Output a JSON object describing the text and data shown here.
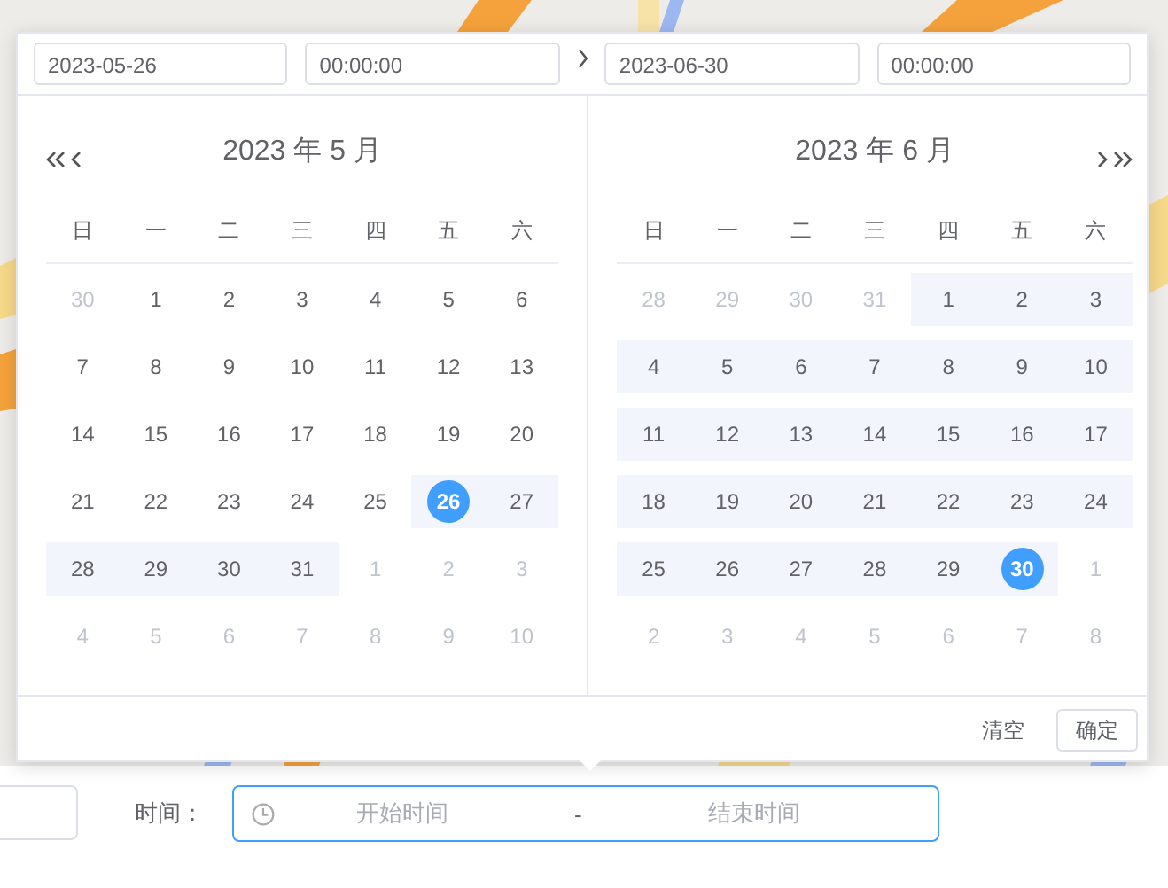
{
  "picker": {
    "start_date": "2023-05-26",
    "start_time": "00:00:00",
    "end_date": "2023-06-30",
    "end_time": "00:00:00",
    "panels": [
      {
        "title": "2023 年 5 月",
        "weekdays": [
          "日",
          "一",
          "二",
          "三",
          "四",
          "五",
          "六"
        ],
        "weeks": [
          [
            {
              "d": "30",
              "muted": true,
              "in_range": false,
              "selected": false
            },
            {
              "d": "1",
              "muted": false,
              "in_range": false,
              "selected": false
            },
            {
              "d": "2",
              "muted": false,
              "in_range": false,
              "selected": false
            },
            {
              "d": "3",
              "muted": false,
              "in_range": false,
              "selected": false
            },
            {
              "d": "4",
              "muted": false,
              "in_range": false,
              "selected": false
            },
            {
              "d": "5",
              "muted": false,
              "in_range": false,
              "selected": false
            },
            {
              "d": "6",
              "muted": false,
              "in_range": false,
              "selected": false
            }
          ],
          [
            {
              "d": "7",
              "muted": false,
              "in_range": false,
              "selected": false
            },
            {
              "d": "8",
              "muted": false,
              "in_range": false,
              "selected": false
            },
            {
              "d": "9",
              "muted": false,
              "in_range": false,
              "selected": false
            },
            {
              "d": "10",
              "muted": false,
              "in_range": false,
              "selected": false
            },
            {
              "d": "11",
              "muted": false,
              "in_range": false,
              "selected": false
            },
            {
              "d": "12",
              "muted": false,
              "in_range": false,
              "selected": false
            },
            {
              "d": "13",
              "muted": false,
              "in_range": false,
              "selected": false
            }
          ],
          [
            {
              "d": "14",
              "muted": false,
              "in_range": false,
              "selected": false
            },
            {
              "d": "15",
              "muted": false,
              "in_range": false,
              "selected": false
            },
            {
              "d": "16",
              "muted": false,
              "in_range": false,
              "selected": false
            },
            {
              "d": "17",
              "muted": false,
              "in_range": false,
              "selected": false
            },
            {
              "d": "18",
              "muted": false,
              "in_range": false,
              "selected": false
            },
            {
              "d": "19",
              "muted": false,
              "in_range": false,
              "selected": false
            },
            {
              "d": "20",
              "muted": false,
              "in_range": false,
              "selected": false
            }
          ],
          [
            {
              "d": "21",
              "muted": false,
              "in_range": false,
              "selected": false
            },
            {
              "d": "22",
              "muted": false,
              "in_range": false,
              "selected": false
            },
            {
              "d": "23",
              "muted": false,
              "in_range": false,
              "selected": false
            },
            {
              "d": "24",
              "muted": false,
              "in_range": false,
              "selected": false
            },
            {
              "d": "25",
              "muted": false,
              "in_range": false,
              "selected": false
            },
            {
              "d": "26",
              "muted": false,
              "in_range": true,
              "selected": true
            },
            {
              "d": "27",
              "muted": false,
              "in_range": true,
              "selected": false
            }
          ],
          [
            {
              "d": "28",
              "muted": false,
              "in_range": true,
              "selected": false
            },
            {
              "d": "29",
              "muted": false,
              "in_range": true,
              "selected": false
            },
            {
              "d": "30",
              "muted": false,
              "in_range": true,
              "selected": false
            },
            {
              "d": "31",
              "muted": false,
              "in_range": true,
              "selected": false
            },
            {
              "d": "1",
              "muted": true,
              "in_range": false,
              "selected": false
            },
            {
              "d": "2",
              "muted": true,
              "in_range": false,
              "selected": false
            },
            {
              "d": "3",
              "muted": true,
              "in_range": false,
              "selected": false
            }
          ],
          [
            {
              "d": "4",
              "muted": true,
              "in_range": false,
              "selected": false
            },
            {
              "d": "5",
              "muted": true,
              "in_range": false,
              "selected": false
            },
            {
              "d": "6",
              "muted": true,
              "in_range": false,
              "selected": false
            },
            {
              "d": "7",
              "muted": true,
              "in_range": false,
              "selected": false
            },
            {
              "d": "8",
              "muted": true,
              "in_range": false,
              "selected": false
            },
            {
              "d": "9",
              "muted": true,
              "in_range": false,
              "selected": false
            },
            {
              "d": "10",
              "muted": true,
              "in_range": false,
              "selected": false
            }
          ]
        ]
      },
      {
        "title": "2023 年 6 月",
        "weekdays": [
          "日",
          "一",
          "二",
          "三",
          "四",
          "五",
          "六"
        ],
        "weeks": [
          [
            {
              "d": "28",
              "muted": true,
              "in_range": false,
              "selected": false
            },
            {
              "d": "29",
              "muted": true,
              "in_range": false,
              "selected": false
            },
            {
              "d": "30",
              "muted": true,
              "in_range": false,
              "selected": false
            },
            {
              "d": "31",
              "muted": true,
              "in_range": false,
              "selected": false
            },
            {
              "d": "1",
              "muted": false,
              "in_range": true,
              "selected": false
            },
            {
              "d": "2",
              "muted": false,
              "in_range": true,
              "selected": false
            },
            {
              "d": "3",
              "muted": false,
              "in_range": true,
              "selected": false
            }
          ],
          [
            {
              "d": "4",
              "muted": false,
              "in_range": true,
              "selected": false
            },
            {
              "d": "5",
              "muted": false,
              "in_range": true,
              "selected": false
            },
            {
              "d": "6",
              "muted": false,
              "in_range": true,
              "selected": false
            },
            {
              "d": "7",
              "muted": false,
              "in_range": true,
              "selected": false
            },
            {
              "d": "8",
              "muted": false,
              "in_range": true,
              "selected": false
            },
            {
              "d": "9",
              "muted": false,
              "in_range": true,
              "selected": false
            },
            {
              "d": "10",
              "muted": false,
              "in_range": true,
              "selected": false
            }
          ],
          [
            {
              "d": "11",
              "muted": false,
              "in_range": true,
              "selected": false
            },
            {
              "d": "12",
              "muted": false,
              "in_range": true,
              "selected": false
            },
            {
              "d": "13",
              "muted": false,
              "in_range": true,
              "selected": false
            },
            {
              "d": "14",
              "muted": false,
              "in_range": true,
              "selected": false
            },
            {
              "d": "15",
              "muted": false,
              "in_range": true,
              "selected": false
            },
            {
              "d": "16",
              "muted": false,
              "in_range": true,
              "selected": false
            },
            {
              "d": "17",
              "muted": false,
              "in_range": true,
              "selected": false
            }
          ],
          [
            {
              "d": "18",
              "muted": false,
              "in_range": true,
              "selected": false
            },
            {
              "d": "19",
              "muted": false,
              "in_range": true,
              "selected": false
            },
            {
              "d": "20",
              "muted": false,
              "in_range": true,
              "selected": false
            },
            {
              "d": "21",
              "muted": false,
              "in_range": true,
              "selected": false
            },
            {
              "d": "22",
              "muted": false,
              "in_range": true,
              "selected": false
            },
            {
              "d": "23",
              "muted": false,
              "in_range": true,
              "selected": false
            },
            {
              "d": "24",
              "muted": false,
              "in_range": true,
              "selected": false
            }
          ],
          [
            {
              "d": "25",
              "muted": false,
              "in_range": true,
              "selected": false
            },
            {
              "d": "26",
              "muted": false,
              "in_range": true,
              "selected": false
            },
            {
              "d": "27",
              "muted": false,
              "in_range": true,
              "selected": false
            },
            {
              "d": "28",
              "muted": false,
              "in_range": true,
              "selected": false
            },
            {
              "d": "29",
              "muted": false,
              "in_range": true,
              "selected": false
            },
            {
              "d": "30",
              "muted": false,
              "in_range": true,
              "selected": true
            },
            {
              "d": "1",
              "muted": true,
              "in_range": false,
              "selected": false
            }
          ],
          [
            {
              "d": "2",
              "muted": true,
              "in_range": false,
              "selected": false
            },
            {
              "d": "3",
              "muted": true,
              "in_range": false,
              "selected": false
            },
            {
              "d": "4",
              "muted": true,
              "in_range": false,
              "selected": false
            },
            {
              "d": "5",
              "muted": true,
              "in_range": false,
              "selected": false
            },
            {
              "d": "6",
              "muted": true,
              "in_range": false,
              "selected": false
            },
            {
              "d": "7",
              "muted": true,
              "in_range": false,
              "selected": false
            },
            {
              "d": "8",
              "muted": true,
              "in_range": false,
              "selected": false
            }
          ]
        ]
      }
    ],
    "buttons": [
      "清空",
      "确定"
    ]
  },
  "form": {
    "label": "时间：",
    "start_placeholder": "开始时间",
    "separator": "-",
    "end_placeholder": "结束时间"
  }
}
